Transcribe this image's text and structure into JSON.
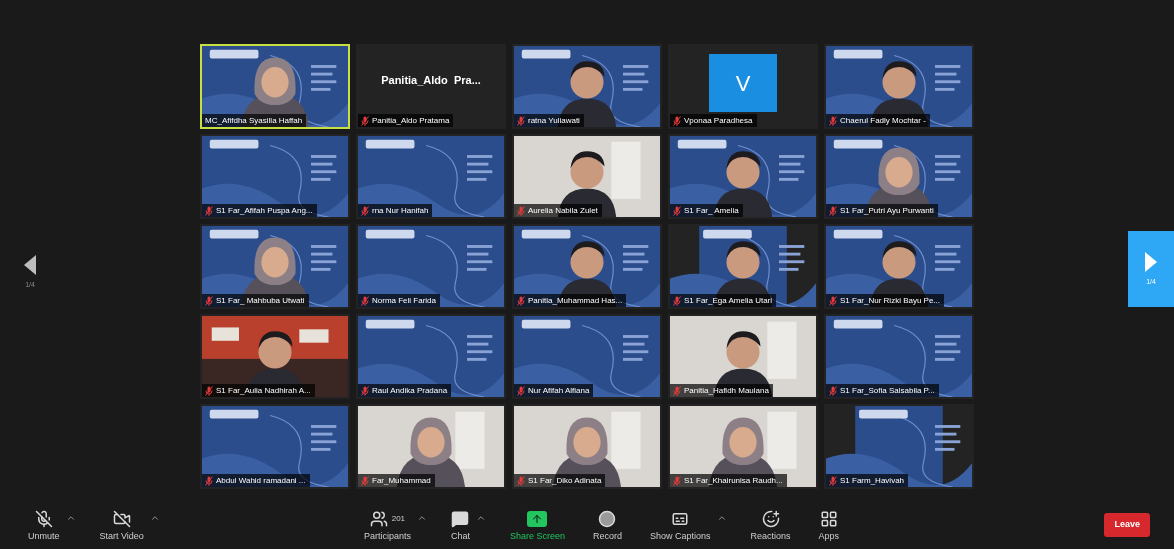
{
  "gallery": {
    "page_prev": "1/4",
    "page_next": "1/4",
    "tiles": [
      {
        "kind": "picture",
        "name": "MC_Afifdha Syasilla Haffah",
        "muted": false,
        "speaking": true
      },
      {
        "kind": "name_card",
        "display_name": "Panitia_Aldo  Pra...",
        "name": "Panitia_Aldo Pratama",
        "muted": true,
        "speaking": false
      },
      {
        "kind": "picture",
        "name": "ratna Yuliawati",
        "muted": true,
        "speaking": false
      },
      {
        "kind": "avatar",
        "letter": "V",
        "name": "Vponaa Paradhesa",
        "muted": true,
        "speaking": false
      },
      {
        "kind": "picture",
        "name": "Chaerul Fadly Mochtar -",
        "muted": true,
        "speaking": false
      },
      {
        "kind": "picture",
        "name": "S1 Far_Afifah Puspa Ang...",
        "muted": true,
        "speaking": false
      },
      {
        "kind": "picture",
        "name": "rna Nur Hanifah",
        "muted": true,
        "speaking": false
      },
      {
        "kind": "picture",
        "name": "Aurelia Nabila Zulet",
        "muted": true,
        "speaking": false
      },
      {
        "kind": "picture",
        "name": "S1 Far_ Amelia",
        "muted": true,
        "speaking": false
      },
      {
        "kind": "picture",
        "name": "S1 Far_Putri Ayu Purwanti",
        "muted": true,
        "speaking": false
      },
      {
        "kind": "picture",
        "name": "S1 Far_ Mahbuba Utwati",
        "muted": true,
        "speaking": false
      },
      {
        "kind": "picture",
        "name": "Norma Feli Farida",
        "muted": true,
        "speaking": false
      },
      {
        "kind": "picture",
        "name": "Panitia_Muhammad Has...",
        "muted": true,
        "speaking": false
      },
      {
        "kind": "picture",
        "name": "S1 Far_Ega Amelia Utari",
        "muted": true,
        "speaking": false
      },
      {
        "kind": "picture",
        "name": "S1 Far_Nur Rizki Bayu Pe...",
        "muted": true,
        "speaking": false
      },
      {
        "kind": "picture",
        "name": "S1 Far_Aulia Nadhirah A...",
        "muted": true,
        "speaking": false
      },
      {
        "kind": "picture",
        "name": "Raul Andika Pradana",
        "muted": true,
        "speaking": false
      },
      {
        "kind": "picture",
        "name": "Nur Afifah Alfiana",
        "muted": true,
        "speaking": false
      },
      {
        "kind": "picture",
        "name": "Panitia_Hafidh Maulana",
        "muted": true,
        "speaking": false
      },
      {
        "kind": "picture",
        "name": "S1 Far_Sofia Salsabila P...",
        "muted": true,
        "speaking": false
      },
      {
        "kind": "picture",
        "name": "Abdul Wahid ramadani ...",
        "muted": true,
        "speaking": false
      },
      {
        "kind": "picture",
        "name": "Far_Muhammad",
        "muted": true,
        "speaking": false
      },
      {
        "kind": "picture",
        "name": "S1 Far_Diko Adinata",
        "muted": true,
        "speaking": false
      },
      {
        "kind": "picture",
        "name": "S1 Far_Khairunisa Raudh...",
        "muted": true,
        "speaking": false
      },
      {
        "kind": "picture",
        "name": "S1 Farm_Havivah",
        "muted": true,
        "speaking": false
      }
    ]
  },
  "toolbar": {
    "left": [
      {
        "kind": "mic",
        "label": "Unmute",
        "caret": true
      },
      {
        "kind": "video",
        "label": "Start Video",
        "caret": true
      }
    ],
    "center": [
      {
        "kind": "participants",
        "label": "Participants",
        "count": "201",
        "caret": true
      },
      {
        "kind": "chat",
        "label": "Chat",
        "caret": true
      },
      {
        "kind": "share",
        "label": "Share Screen",
        "caret": false
      },
      {
        "kind": "record",
        "label": "Record",
        "caret": false
      },
      {
        "kind": "captions",
        "label": "Show Captions",
        "caret": true
      },
      {
        "kind": "reactions",
        "label": "Reactions",
        "caret": false
      },
      {
        "kind": "apps",
        "label": "Apps",
        "caret": false
      }
    ],
    "leave": "Leave"
  }
}
